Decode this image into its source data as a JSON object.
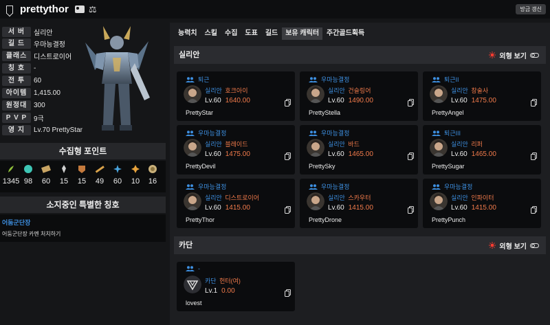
{
  "header": {
    "title": "prettythor",
    "refresh_label": "방금 갱신"
  },
  "profile": {
    "rows": [
      {
        "label": "서 버",
        "value": "실리안"
      },
      {
        "label": "길 드",
        "value": "우마능결정"
      },
      {
        "label": "클래스",
        "value": "디스트로이어"
      },
      {
        "label": "칭 호",
        "value": "-"
      },
      {
        "label": "전 투",
        "value": "60"
      },
      {
        "label": "아이템",
        "value": "1,415.00"
      },
      {
        "label": "원정대",
        "value": "300"
      },
      {
        "label": "P V P",
        "value": "9극"
      },
      {
        "label": "영 지",
        "value": "Lv.70 PrettyStar"
      }
    ]
  },
  "collect": {
    "heading": "수집형 포인트",
    "items": [
      {
        "icon": "mokoko-seed-icon",
        "value": "1345",
        "color": "#8fbf3a"
      },
      {
        "icon": "island-heart-icon",
        "value": "98",
        "color": "#3ec6b5"
      },
      {
        "icon": "giant-heart-icon",
        "value": "60",
        "color": "#c8a463"
      },
      {
        "icon": "ignea-token-icon",
        "value": "15",
        "color": "#d0d0d0"
      },
      {
        "icon": "art-icon",
        "value": "15",
        "color": "#c47a3d"
      },
      {
        "icon": "voyage-icon",
        "value": "49",
        "color": "#d9a24a"
      },
      {
        "icon": "sea-bounty-icon",
        "value": "60",
        "color": "#4aa6e0"
      },
      {
        "icon": "world-tree-leaf-icon",
        "value": "10",
        "color": "#e8a33c"
      },
      {
        "icon": "orpheus-star-icon",
        "value": "16",
        "color": "#c9b07a"
      }
    ]
  },
  "titles": {
    "heading": "소지중인 특별한 칭호",
    "name": "어둠군단장",
    "desc": "어둠군단장 카멘 처치하기"
  },
  "tabs": [
    "능력치",
    "스킬",
    "수집",
    "도표",
    "길드",
    "보유 캐릭터",
    "주간골드획득"
  ],
  "active_tab": "보유 캐릭터",
  "servers": [
    {
      "name": "실리안",
      "view_label": "외형 보기",
      "characters": [
        {
          "guild": "퇴근",
          "server": "실리안",
          "cls": "호크아이",
          "level": "Lv.60",
          "item_level": "1640.00",
          "name": "PrettyStar"
        },
        {
          "guild": "우마능결정",
          "server": "실리안",
          "cls": "건슬링어",
          "level": "Lv.60",
          "item_level": "1490.00",
          "name": "PrettyStella"
        },
        {
          "guild": "퇴근II",
          "server": "실리안",
          "cls": "창술사",
          "level": "Lv.60",
          "item_level": "1475.00",
          "name": "PrettyAngel"
        },
        {
          "guild": "우마능결정",
          "server": "실리안",
          "cls": "블레이드",
          "level": "Lv.60",
          "item_level": "1475.00",
          "name": "PrettyDevil"
        },
        {
          "guild": "우마능결정",
          "server": "실리안",
          "cls": "바드",
          "level": "Lv.60",
          "item_level": "1465.00",
          "name": "PrettySky"
        },
        {
          "guild": "퇴근III",
          "server": "실리안",
          "cls": "리퍼",
          "level": "Lv.60",
          "item_level": "1465.00",
          "name": "PrettySugar"
        },
        {
          "guild": "우마능결정",
          "server": "실리안",
          "cls": "디스트로이어",
          "level": "Lv.60",
          "item_level": "1415.00",
          "name": "PrettyThor"
        },
        {
          "guild": "우마능결정",
          "server": "실리안",
          "cls": "스카우터",
          "level": "Lv.60",
          "item_level": "1415.00",
          "name": "PrettyDrone"
        },
        {
          "guild": "우마능결정",
          "server": "실리안",
          "cls": "인파이터",
          "level": "Lv.60",
          "item_level": "1415.00",
          "name": "PrettyPunch"
        }
      ]
    },
    {
      "name": "카단",
      "view_label": "외형 보기",
      "characters": [
        {
          "guild": "-",
          "server": "카단",
          "cls": "헌터(여)",
          "level": "Lv.1",
          "item_level": "0.00",
          "name": "lovest"
        }
      ]
    }
  ],
  "colors": {
    "accent_blue": "#3d8fe0",
    "accent_orange": "#f27b4b",
    "sun_red": "#ff3b30"
  }
}
